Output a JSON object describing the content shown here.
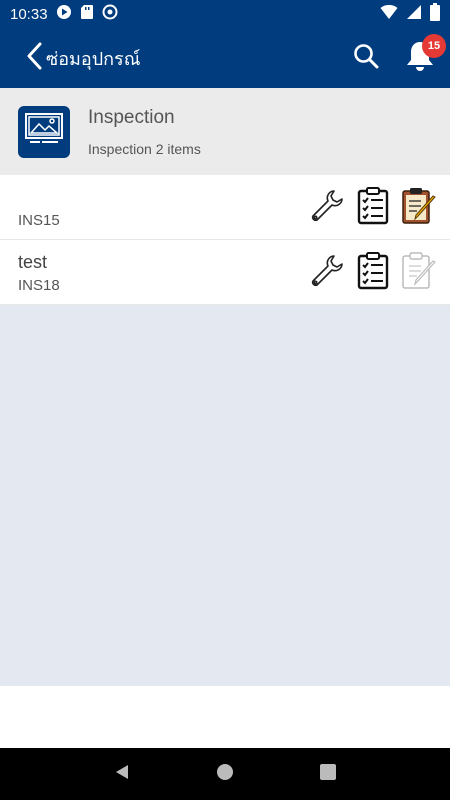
{
  "status_bar": {
    "time": "10:33"
  },
  "app_bar": {
    "title": "ซ่อมอุปกรณ์",
    "notification_count": "15"
  },
  "header": {
    "title": "Inspection",
    "subtitle": "Inspection 2 items"
  },
  "items": [
    {
      "name": "",
      "code": "INS15",
      "actions": [
        "wrench-icon",
        "checklist-icon",
        "clipboard-edit-icon"
      ],
      "edit_active": true
    },
    {
      "name": "test",
      "code": "INS18",
      "actions": [
        "wrench-icon",
        "checklist-icon",
        "clipboard-edit-icon"
      ],
      "edit_active": false
    }
  ],
  "colors": {
    "primary": "#003c7e",
    "badge": "#e53935",
    "empty_bg": "#e4e8f0",
    "header_bg": "#ebebeb"
  }
}
